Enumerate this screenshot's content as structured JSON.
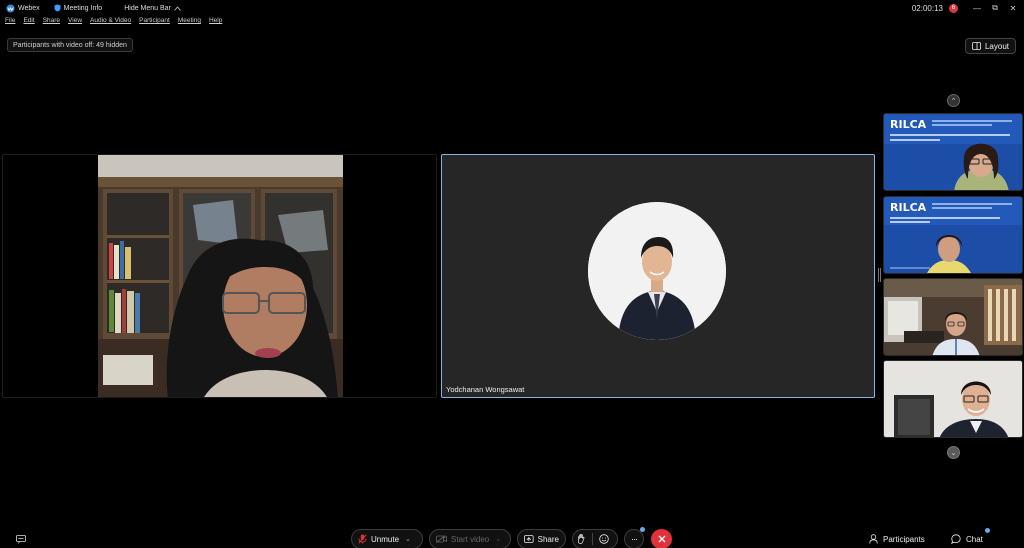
{
  "titlebar": {
    "app_name": "Webex",
    "meeting_info": "Meeting Info",
    "hide_menu": "Hide Menu Bar",
    "clock": "02:00:13",
    "rec_count": "6"
  },
  "menu": [
    "File",
    "Edit",
    "Share",
    "View",
    "Audio & Video",
    "Participant",
    "Meeting",
    "Help"
  ],
  "hidden_chip": "Participants with video off: 49 hidden",
  "layout_label": "Layout",
  "main": {
    "active_speaker_name": "Yodchanan Wongsawat"
  },
  "controls": {
    "unmute": "Unmute",
    "start_video": "Start video",
    "share": "Share",
    "participants": "Participants",
    "chat": "Chat"
  },
  "colors": {
    "accent": "#7eb6e8",
    "end": "#e0323b",
    "mic_muted": "#e0323b"
  }
}
